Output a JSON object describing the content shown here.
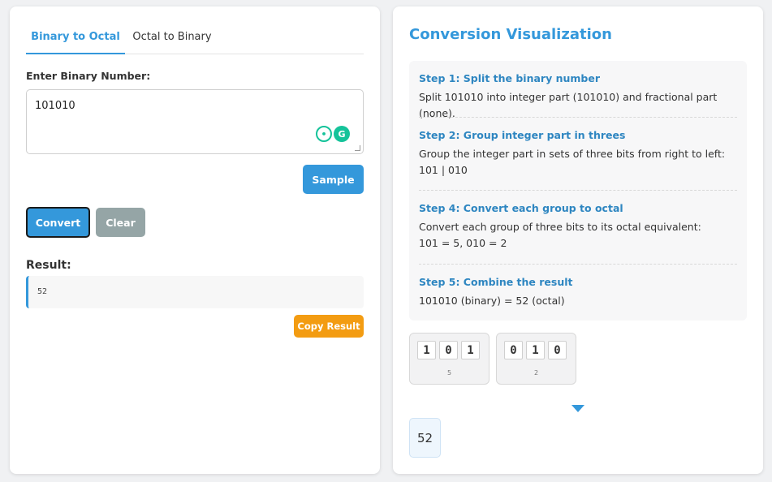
{
  "tabs": [
    {
      "label": "Binary to Octal",
      "active": true
    },
    {
      "label": "Octal to Binary",
      "active": false
    }
  ],
  "input": {
    "label": "Enter Binary Number:",
    "value": "101010"
  },
  "buttons": {
    "sample": "Sample",
    "convert": "Convert",
    "clear": "Clear",
    "copy": "Copy Result"
  },
  "result": {
    "label": "Result:",
    "value": "52"
  },
  "visualization": {
    "title": "Conversion Visualization",
    "steps": [
      {
        "title": "Step 1: Split the binary number",
        "text": "Split 101010 into integer part (101010) and fractional part (none)."
      },
      {
        "title": "Step 2: Group integer part in threes",
        "text": "Group the integer part in sets of three bits from right to left: 101 | 010"
      },
      {
        "title": "Step 4: Convert each group to octal",
        "text_line1": "Convert each group of three bits to its octal equivalent:",
        "text_line2": "101 = 5, 010 = 2"
      },
      {
        "title": "Step 5: Combine the result",
        "text": "101010 (binary) = 52 (octal)"
      }
    ],
    "groups": [
      {
        "bits": [
          "1",
          "0",
          "1"
        ],
        "value": "5"
      },
      {
        "bits": [
          "0",
          "1",
          "0"
        ],
        "value": "2"
      }
    ],
    "final": "52"
  },
  "colors": {
    "accent": "#3498db",
    "clear": "#95a5a6",
    "copy": "#f39c12"
  },
  "icons": [
    "grammarly-bulb-icon",
    "grammarly-g-icon",
    "arrow-down-icon"
  ]
}
